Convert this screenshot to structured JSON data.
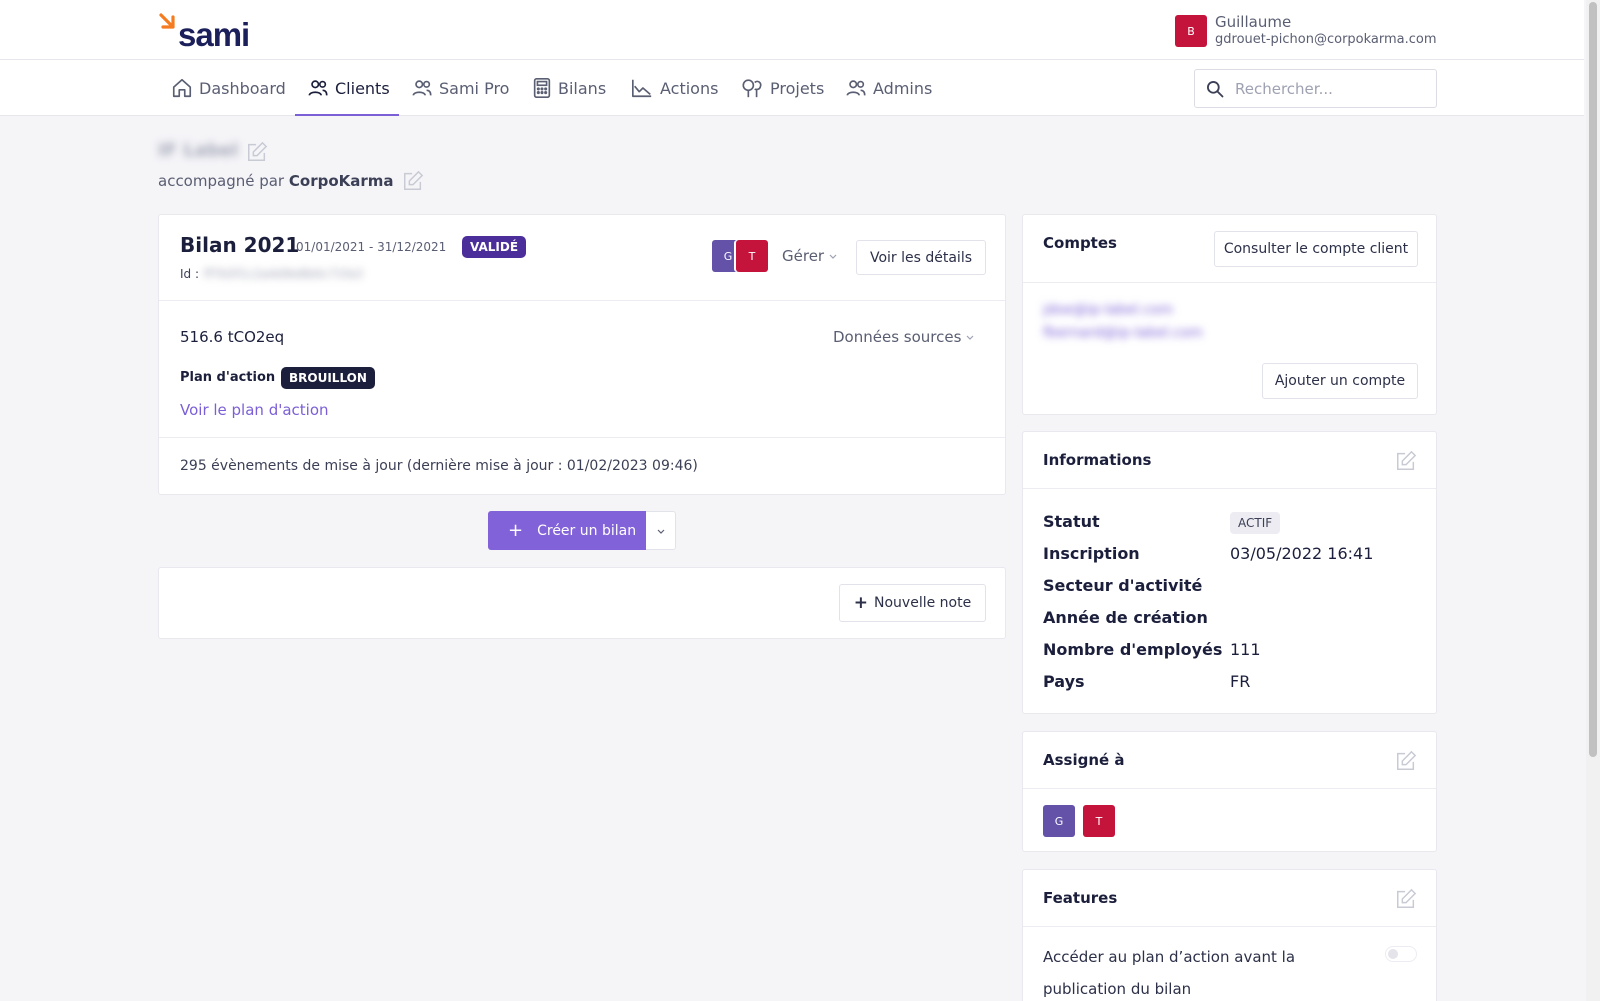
{
  "brand": {
    "logo_text": "sami",
    "accent": "#f47b20",
    "primary": "#7b5fd6",
    "dark": "#1b1f5a"
  },
  "user": {
    "avatar_letter": "B",
    "name": "Guillaume",
    "email": "gdrouet-pichon@corpokarma.com"
  },
  "nav": {
    "items": [
      {
        "label": "Dashboard",
        "icon": "home-icon"
      },
      {
        "label": "Clients",
        "icon": "users-icon"
      },
      {
        "label": "Sami Pro",
        "icon": "users-icon"
      },
      {
        "label": "Bilans",
        "icon": "calculator-icon"
      },
      {
        "label": "Actions",
        "icon": "chart-line-icon"
      },
      {
        "label": "Projets",
        "icon": "trees-icon"
      },
      {
        "label": "Admins",
        "icon": "users-icon"
      }
    ],
    "active": "Clients",
    "search_placeholder": "Rechercher..."
  },
  "client": {
    "name": "IF Label",
    "accompanied_prefix": "accompagné par",
    "accompanied_by": "CorpoKarma"
  },
  "bilan": {
    "title": "Bilan 2021",
    "period": "01/01/2021 - 31/12/2021",
    "status": "VALIDÉ",
    "id_label": "Id :",
    "id_value": "ff7b5f1c2a4d9e8b0c71fa3",
    "assignee_letters": [
      "G",
      "T"
    ],
    "manage_label": "Gérer",
    "details_button": "Voir les détails",
    "emissions": "516.6 tCO2eq",
    "sources_label": "Données sources",
    "action_plan_label": "Plan d'action",
    "action_plan_status": "BROUILLON",
    "action_plan_link": "Voir le plan d'action",
    "events": "295 évènements de mise à jour (dernière mise à jour : 01/02/2023 09:46)"
  },
  "create_bilan": {
    "icon": "+",
    "label": "Créer un bilan"
  },
  "notes": {
    "new_note": "Nouvelle note"
  },
  "comptes": {
    "title": "Comptes",
    "consult_button": "Consulter le compte client",
    "emails": [
      "jdoe@ip-label.com",
      "fbernard@ip-label.com"
    ],
    "add_button": "Ajouter un compte"
  },
  "informations": {
    "title": "Informations",
    "rows": [
      {
        "label": "Statut",
        "value": "ACTIF",
        "type": "badge"
      },
      {
        "label": "Inscription",
        "value": "03/05/2022 16:41"
      },
      {
        "label": "Secteur d'activité",
        "value": ""
      },
      {
        "label": "Année de création",
        "value": ""
      },
      {
        "label": "Nombre d'employés",
        "value": "111"
      },
      {
        "label": "Pays",
        "value": "FR"
      }
    ]
  },
  "assigned": {
    "title": "Assigné à",
    "letters": [
      "G",
      "T"
    ]
  },
  "features": {
    "title": "Features",
    "item_line1": "Accéder au plan d’action avant la",
    "item_line2": "publication du bilan",
    "toggle_on": false
  },
  "colors": {
    "avatar_g": "#6352a8",
    "avatar_t": "#c4143c",
    "avatar_b": "#c4143c",
    "badge_valide": "#4b2e9a",
    "badge_brouillon": "#1b1f3b"
  }
}
